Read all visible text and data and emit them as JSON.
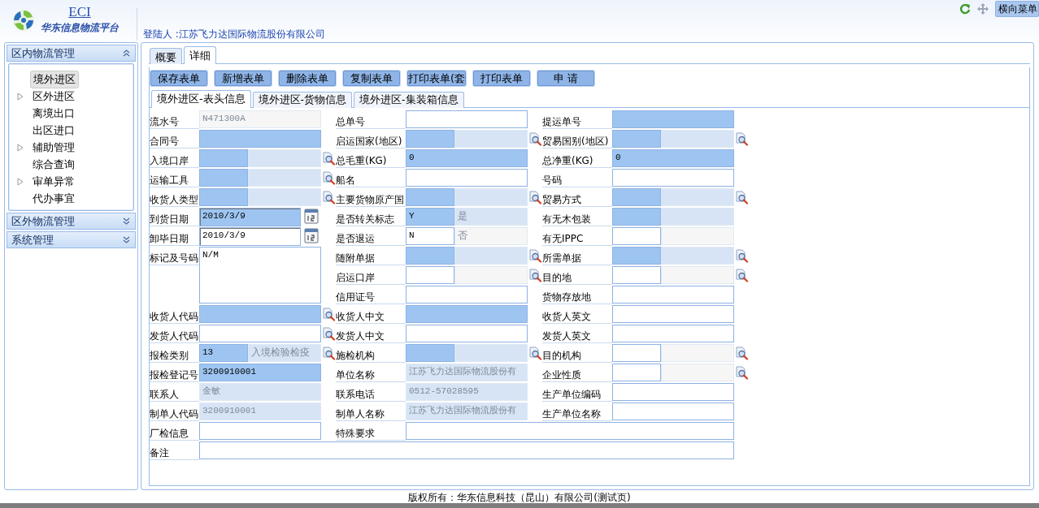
{
  "header": {
    "logo_title": "ECI",
    "logo_subtitle": "华东信息物流平台",
    "login": "登陆人 :江苏飞力达国际物流股份有限公司",
    "menu_button": "横向菜单"
  },
  "sidebar": {
    "sections": [
      {
        "title": "区内物流管理",
        "expanded": true,
        "items": [
          {
            "label": "境外进区",
            "selected": true,
            "expandable": false
          },
          {
            "label": "区外进区",
            "selected": false,
            "expandable": true
          },
          {
            "label": "离境出口",
            "selected": false,
            "expandable": false
          },
          {
            "label": "出区进口",
            "selected": false,
            "expandable": false
          },
          {
            "label": "辅助管理",
            "selected": false,
            "expandable": true
          },
          {
            "label": "综合查询",
            "selected": false,
            "expandable": false
          },
          {
            "label": "审单异常",
            "selected": false,
            "expandable": true
          },
          {
            "label": "代办事宜",
            "selected": false,
            "expandable": false
          }
        ]
      },
      {
        "title": "区外物流管理",
        "expanded": false
      },
      {
        "title": "系统管理",
        "expanded": false
      }
    ]
  },
  "tabs": [
    {
      "label": "概要",
      "selected": false
    },
    {
      "label": "详细",
      "selected": true
    }
  ],
  "toolbar": [
    "保存表单",
    "新增表单",
    "删除表单",
    "复制表单",
    "打印表单(套",
    "打印表单",
    "申 请"
  ],
  "subtabs": [
    {
      "label": "境外进区-表头信息",
      "selected": true
    },
    {
      "label": "境外进区-货物信息",
      "selected": false
    },
    {
      "label": "境外进区-集装箱信息",
      "selected": false
    }
  ],
  "form": {
    "rows": [
      {
        "left": {
          "label": "流水号",
          "field": {
            "kind": "text",
            "value": "N471300A",
            "required": false,
            "disabled": true
          },
          "lookup": false
        },
        "middle": {
          "label": "总单号",
          "field": {
            "kind": "text",
            "required": false,
            "disabled": false
          },
          "lookup": false
        },
        "right": {
          "label": "提运单号",
          "field": {
            "kind": "text",
            "required": true,
            "disabled": false
          },
          "lookup": false
        }
      },
      {
        "left": {
          "label": "合同号",
          "field": {
            "kind": "text",
            "required": true,
            "disabled": false
          },
          "lookup": false
        },
        "middle": {
          "label": "启运国家(地区)",
          "field": {
            "kind": "pair",
            "code": {
              "required": true,
              "disabled": false
            },
            "name": {
              "required": true,
              "disabled": true
            }
          },
          "lookup": true
        },
        "right": {
          "label": "贸易国别(地区)",
          "field": {
            "kind": "pair",
            "code": {
              "required": true,
              "disabled": false
            },
            "name": {
              "required": true,
              "disabled": true
            }
          },
          "lookup": true
        }
      },
      {
        "left": {
          "label": "入境口岸",
          "field": {
            "kind": "pair",
            "code": {
              "required": true,
              "disabled": false
            },
            "name": {
              "required": true,
              "disabled": true
            }
          },
          "lookup": true
        },
        "middle": {
          "label": "总毛重(KG)",
          "field": {
            "kind": "text",
            "value": "0",
            "required": true,
            "disabled": false
          },
          "lookup": false
        },
        "right": {
          "label": "总净重(KG)",
          "field": {
            "kind": "text",
            "value": "0",
            "required": true,
            "disabled": false
          },
          "lookup": false
        }
      },
      {
        "left": {
          "label": "运输工具",
          "field": {
            "kind": "pair",
            "code": {
              "required": true,
              "disabled": false
            },
            "name": {
              "required": true,
              "disabled": true
            }
          },
          "lookup": true
        },
        "middle": {
          "label": "船名",
          "field": {
            "kind": "text",
            "required": false,
            "disabled": false
          },
          "lookup": false
        },
        "right": {
          "label": "号码",
          "field": {
            "kind": "text",
            "required": false,
            "disabled": false
          },
          "lookup": false
        }
      },
      {
        "left": {
          "label": "收货人类型",
          "field": {
            "kind": "pair",
            "code": {
              "required": true,
              "disabled": false
            },
            "name": {
              "required": true,
              "disabled": true
            }
          },
          "lookup": true
        },
        "middle": {
          "label": "主要货物原产国",
          "field": {
            "kind": "pair",
            "code": {
              "required": true,
              "disabled": false
            },
            "name": {
              "required": true,
              "disabled": true
            }
          },
          "lookup": true
        },
        "right": {
          "label": "贸易方式",
          "field": {
            "kind": "pair",
            "code": {
              "required": true,
              "disabled": false
            },
            "name": {
              "required": true,
              "disabled": true
            }
          },
          "lookup": true
        }
      },
      {
        "left": {
          "label": "到货日期",
          "field": {
            "kind": "date",
            "value": "2010/3/9",
            "required": true,
            "disabled": false
          },
          "lookup": false
        },
        "middle": {
          "label": "是否转关标志",
          "field": {
            "kind": "pair",
            "code": {
              "value": "Y",
              "required": true,
              "disabled": false
            },
            "name": {
              "value": "是",
              "required": true,
              "disabled": true
            }
          },
          "lookup": false
        },
        "right": {
          "label": "有无木包装",
          "field": {
            "kind": "pair",
            "code": {
              "required": true,
              "disabled": false
            },
            "name": {
              "required": true,
              "disabled": true
            }
          },
          "lookup": false
        }
      },
      {
        "left": {
          "label": "卸毕日期",
          "field": {
            "kind": "date",
            "value": "2010/3/9",
            "required": false,
            "disabled": false
          },
          "lookup": false
        },
        "middle": {
          "label": "是否退运",
          "field": {
            "kind": "pair",
            "code": {
              "value": "N",
              "required": false,
              "disabled": false
            },
            "name": {
              "value": "否",
              "required": false,
              "disabled": true
            }
          },
          "lookup": false
        },
        "right": {
          "label": "有无IPPC",
          "field": {
            "kind": "pair",
            "code": {
              "required": false,
              "disabled": false
            },
            "name": {
              "required": false,
              "disabled": true
            }
          },
          "lookup": false
        }
      },
      {
        "left": {
          "label": "标记及号码",
          "field": {
            "kind": "memo",
            "value": "N/M",
            "required": false,
            "disabled": false
          },
          "lookup": false
        },
        "middle": {
          "label": "随附单据",
          "field": {
            "kind": "pair",
            "code": {
              "required": true,
              "disabled": false
            },
            "name": {
              "required": true,
              "disabled": true
            }
          },
          "lookup": true
        },
        "right": {
          "label": "所需单据",
          "field": {
            "kind": "pair",
            "code": {
              "required": true,
              "disabled": false
            },
            "name": {
              "required": true,
              "disabled": true
            }
          },
          "lookup": true
        }
      },
      {
        "middle": {
          "label": "启运口岸",
          "field": {
            "kind": "pair",
            "code": {
              "required": false,
              "disabled": false
            },
            "name": {
              "required": false,
              "disabled": true
            }
          },
          "lookup": true
        },
        "right": {
          "label": "目的地",
          "field": {
            "kind": "pair",
            "code": {
              "required": false,
              "disabled": false
            },
            "name": {
              "required": false,
              "disabled": true
            }
          },
          "lookup": true
        }
      },
      {
        "middle": {
          "label": "信用证号",
          "field": {
            "kind": "text",
            "required": false,
            "disabled": false
          },
          "lookup": false
        },
        "right": {
          "label": "货物存放地",
          "field": {
            "kind": "text",
            "required": false,
            "disabled": false
          },
          "lookup": false
        }
      },
      {
        "left": {
          "label": "收货人代码",
          "field": {
            "kind": "text",
            "required": true,
            "disabled": false
          },
          "lookup": true
        },
        "middle": {
          "label": "收货人中文",
          "field": {
            "kind": "text",
            "required": true,
            "disabled": false
          },
          "lookup": false
        },
        "right": {
          "label": "收货人英文",
          "field": {
            "kind": "text",
            "required": false,
            "disabled": false
          },
          "lookup": false
        }
      },
      {
        "left": {
          "label": "发货人代码",
          "field": {
            "kind": "text",
            "required": false,
            "disabled": false
          },
          "lookup": true
        },
        "middle": {
          "label": "发货人中文",
          "field": {
            "kind": "text",
            "required": false,
            "disabled": false
          },
          "lookup": false
        },
        "right": {
          "label": "发货人英文",
          "field": {
            "kind": "text",
            "required": false,
            "disabled": false
          },
          "lookup": false
        }
      },
      {
        "left": {
          "label": "报检类别",
          "field": {
            "kind": "pair",
            "code": {
              "value": "13",
              "required": true,
              "disabled": false
            },
            "name": {
              "value": "入境检验检疫",
              "required": true,
              "disabled": true
            }
          },
          "lookup": true
        },
        "middle": {
          "label": "施检机构",
          "field": {
            "kind": "pair",
            "code": {
              "required": true,
              "disabled": false
            },
            "name": {
              "required": true,
              "disabled": true
            }
          },
          "lookup": true
        },
        "right": {
          "label": "目的机构",
          "field": {
            "kind": "pair",
            "code": {
              "required": false,
              "disabled": false
            },
            "name": {
              "required": false,
              "disabled": true
            }
          },
          "lookup": true
        }
      },
      {
        "left": {
          "label": "报检登记号",
          "field": {
            "kind": "text",
            "value": "3200910001",
            "required": true,
            "disabled": false
          },
          "lookup": false
        },
        "middle": {
          "label": "单位名称",
          "field": {
            "kind": "text",
            "value": "江苏飞力达国际物流股份有",
            "required": true,
            "disabled": true
          },
          "lookup": false
        },
        "right": {
          "label": "企业性质",
          "field": {
            "kind": "pair",
            "code": {
              "required": false,
              "disabled": false
            },
            "name": {
              "required": false,
              "disabled": true
            }
          },
          "lookup": true
        }
      },
      {
        "left": {
          "label": "联系人",
          "field": {
            "kind": "text",
            "value": "金敏",
            "required": true,
            "disabled": true
          },
          "lookup": false
        },
        "middle": {
          "label": "联系电话",
          "field": {
            "kind": "text",
            "value": "0512-57028595",
            "required": true,
            "disabled": true
          },
          "lookup": false
        },
        "right": {
          "label": "生产单位编码",
          "field": {
            "kind": "text",
            "required": false,
            "disabled": false
          },
          "lookup": false
        }
      },
      {
        "left": {
          "label": "制单人代码",
          "field": {
            "kind": "text",
            "value": "3200910001",
            "required": true,
            "disabled": true
          },
          "lookup": false
        },
        "middle": {
          "label": "制单人名称",
          "field": {
            "kind": "text",
            "value": "江苏飞力达国际物流股份有",
            "required": true,
            "disabled": true
          },
          "lookup": false
        },
        "right": {
          "label": "生产单位名称",
          "field": {
            "kind": "text",
            "required": false,
            "disabled": false
          },
          "lookup": false
        }
      },
      {
        "left": {
          "label": "厂检信息",
          "field": {
            "kind": "text",
            "required": false,
            "disabled": false
          },
          "lookup": false
        },
        "middle": {
          "label": "特殊要求",
          "field": {
            "kind": "long",
            "required": false,
            "disabled": false
          },
          "lookup": false
        }
      },
      {
        "left": {
          "label": "备注",
          "field": {
            "kind": "long",
            "required": false,
            "disabled": false
          },
          "lookup": false
        }
      }
    ]
  },
  "footer": "版权所有：华东信息科技（昆山）有限公司(测试页)"
}
